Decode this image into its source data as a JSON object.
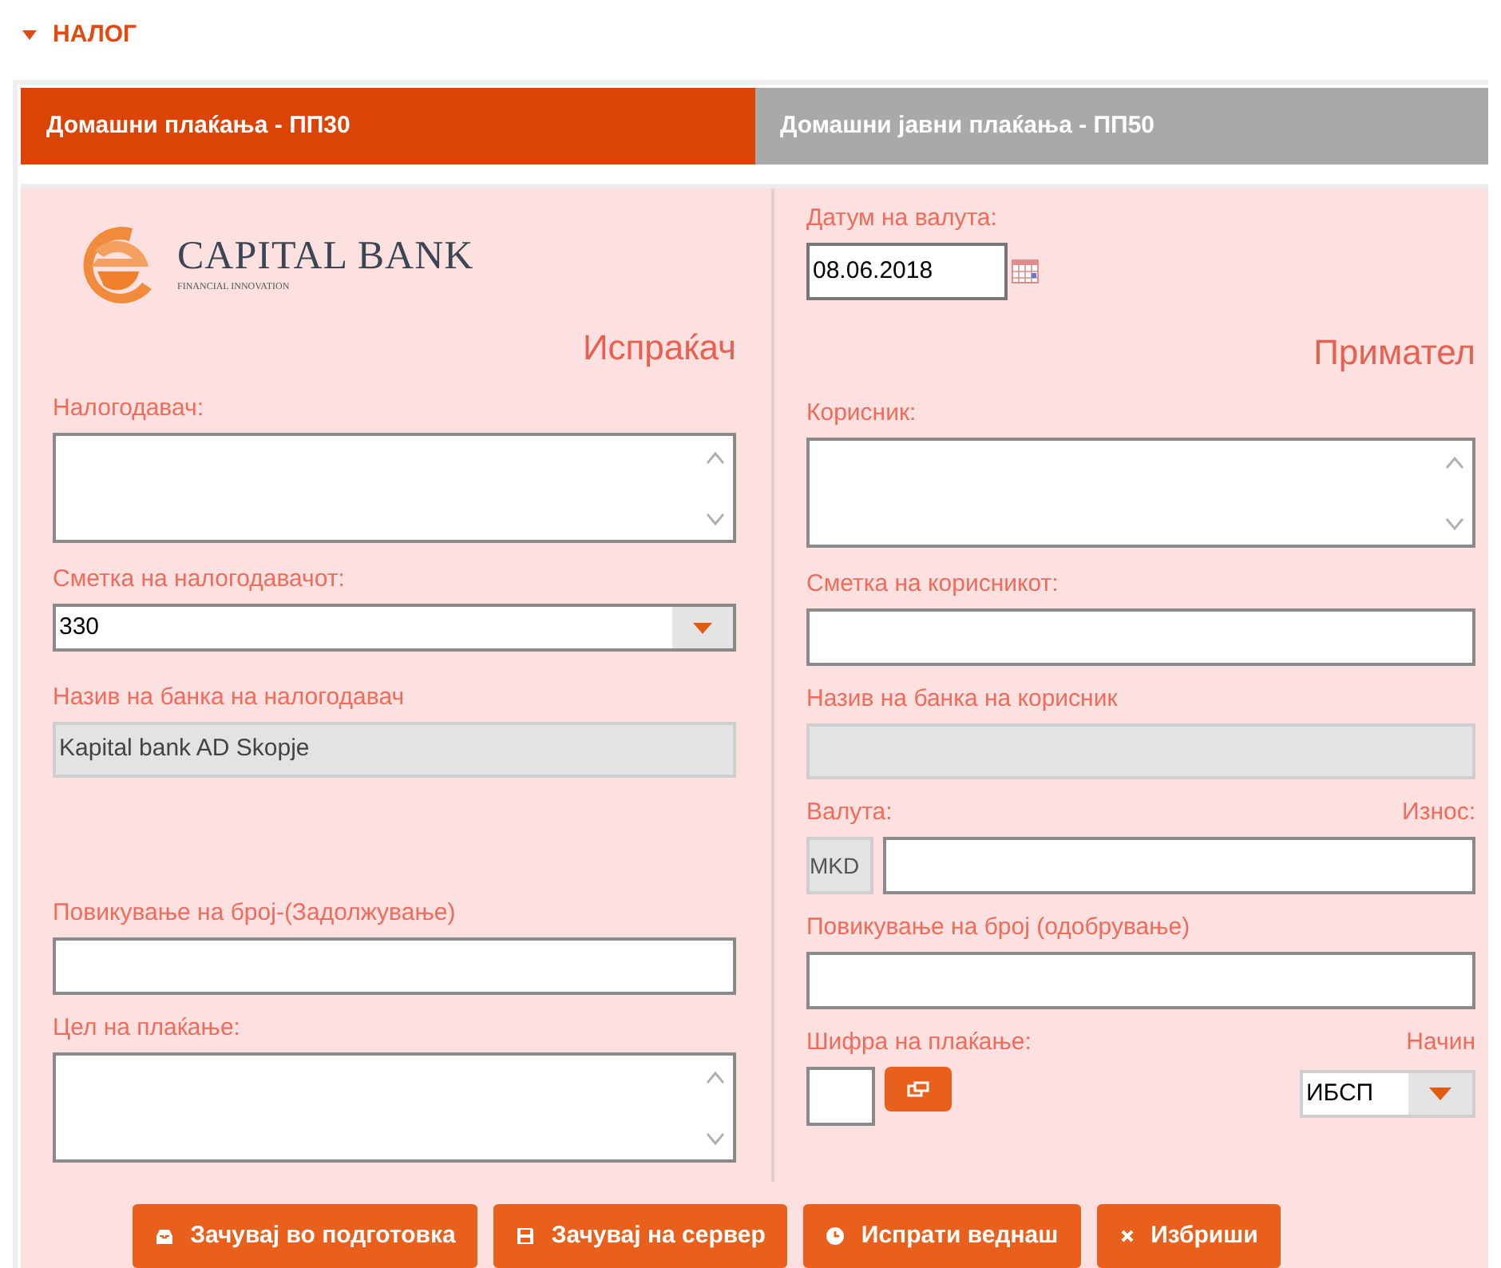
{
  "section": {
    "title": "НАЛОГ",
    "expanded": true
  },
  "tabs": [
    {
      "label": "Домашни плаќања - ПП30",
      "selected": true
    },
    {
      "label": "Домашни јавни плаќања - ПП50",
      "selected": false
    }
  ],
  "logo": {
    "name": "CAPITAL BANK",
    "tagline": "FINANCIAL INNOVATION"
  },
  "value_date": {
    "label": "Датум на валута:",
    "value": "08.06.2018"
  },
  "sender": {
    "heading": "Испраќач",
    "fields": [
      {
        "kind": "textarea",
        "label": "Налогодавач:"
      },
      {
        "kind": "select",
        "label": "Сметка на налогодавачот:",
        "value": "330"
      },
      {
        "kind": "readonly",
        "label": "Назив на банка на налогодавач",
        "value": "Kapital bank AD Skopje"
      },
      {
        "kind": "input",
        "label": "Повикување на број-(Задолжување)"
      },
      {
        "kind": "textarea",
        "label": "Цел на плаќање:"
      }
    ]
  },
  "receiver": {
    "heading": "Примател",
    "fields": [
      {
        "kind": "textarea",
        "label": "Корисник:"
      },
      {
        "kind": "input",
        "label": "Сметка на корисникот:"
      },
      {
        "kind": "readonly",
        "label": "Назив на банка на корисник"
      },
      {
        "kind": "amount",
        "label": "Валута:",
        "label_right": "Износ:",
        "currency": "MKD"
      },
      {
        "kind": "input",
        "label": "Повикување на број (одобрување)"
      },
      {
        "kind": "code",
        "label": "Шифра на плаќање:",
        "label_right": "Начин",
        "value": "ИБСП"
      }
    ]
  },
  "buttons": [
    {
      "kind": "draft",
      "label": "Зачувај во подготовка"
    },
    {
      "kind": "save",
      "label": "Зачувај на сервер"
    },
    {
      "kind": "send",
      "label": "Испрати веднаш"
    },
    {
      "kind": "delete",
      "label": "Избриши"
    }
  ]
}
